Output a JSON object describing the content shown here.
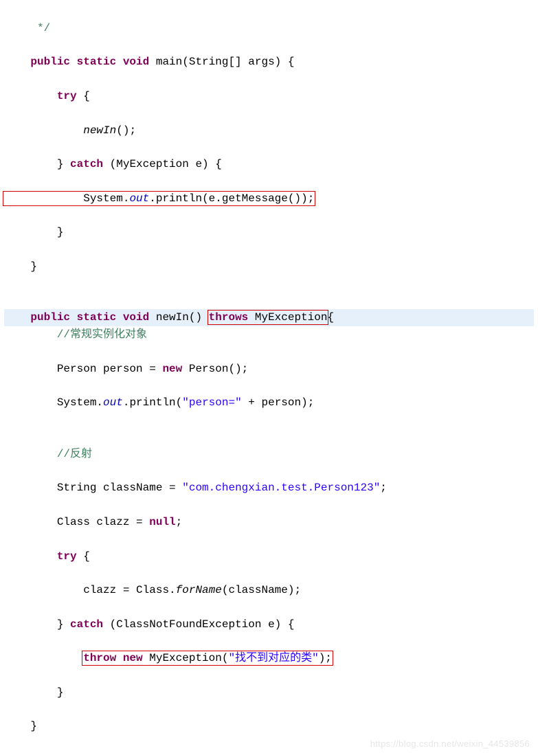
{
  "code": {
    "l1": "     */",
    "l2_1": "    public static void",
    "l2_2": " main(String[] args) {",
    "l3_1": "        try",
    "l3_2": " {",
    "l4_1": "            ",
    "l4_2": "newIn",
    "l4_3": "();",
    "l5_1": "        } ",
    "l5_2": "catch",
    "l5_3": " (MyException e) {",
    "l6_1": "            System.",
    "l6_2": "out",
    "l6_3": ".println(e.getMessage());",
    "l7": "        }",
    "l8": "    }",
    "l9": "",
    "l10_1": "    public static void",
    "l10_2": " newIn() ",
    "l10_3": "throws",
    "l10_4": " MyException",
    "l10_5": "{",
    "l11_1": "        ",
    "l11_2": "//常规实例化对象",
    "l12_1": "        Person person = ",
    "l12_2": "new",
    "l12_3": " Person();",
    "l13_1": "        System.",
    "l13_2": "out",
    "l13_3": ".println(",
    "l13_4": "\"person=\"",
    "l13_5": " + person);",
    "l14": "",
    "l15_1": "        ",
    "l15_2": "//反射",
    "l16_1": "        String className = ",
    "l16_2": "\"com.chengxian.test.Person123\"",
    "l16_3": ";",
    "l17_1": "        Class clazz = ",
    "l17_2": "null",
    "l17_3": ";",
    "l18_1": "        try",
    "l18_2": " {",
    "l19_1": "            clazz = Class.",
    "l19_2": "forName",
    "l19_3": "(className);",
    "l20_1": "        } ",
    "l20_2": "catch",
    "l20_3": " (ClassNotFoundException e) {",
    "l21_1": "            ",
    "l21_2": "throw new",
    "l21_3": " MyException(",
    "l21_4": "\"找不到对应的类\"",
    "l21_5": ");",
    "l22": "        }",
    "l23": "    }"
  },
  "watermark": "https://blog.csdn.net/weixin_44539856"
}
